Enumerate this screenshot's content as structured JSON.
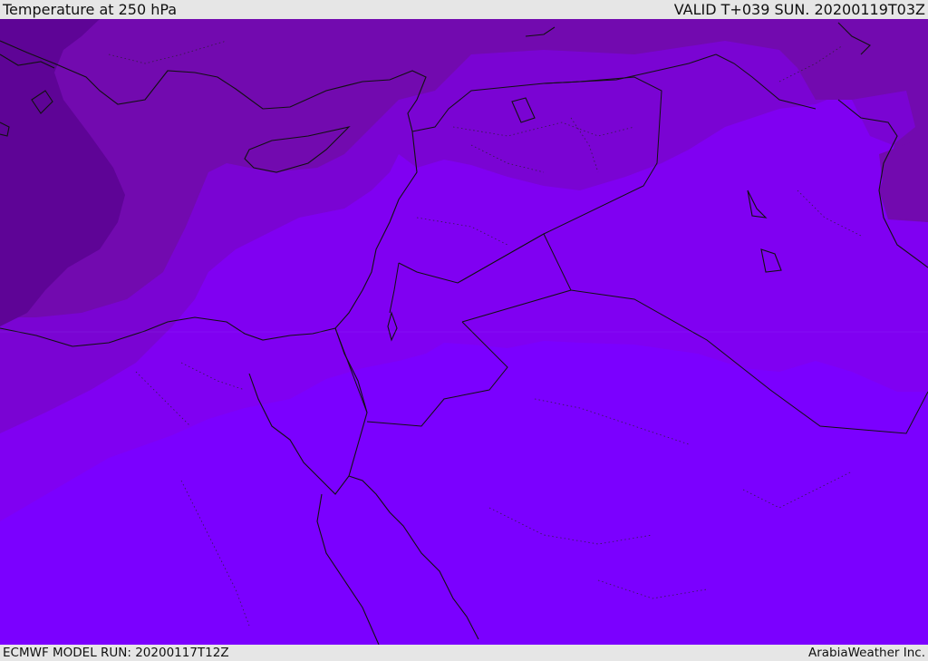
{
  "header": {
    "title": "Temperature at 250 hPa",
    "valid": "VALID T+039 SUN. 20200119T03Z"
  },
  "footer": {
    "model_run": "ECMWF MODEL RUN: 20200117T12Z",
    "credit": "ArabiaWeather Inc."
  },
  "colors": {
    "band_darkest": "#5e0496",
    "band_dark": "#720aaf",
    "band_mid": "#7a04d3",
    "band_light": "#8000f2",
    "band_lightest": "#7b00ff",
    "coastline": "#111111"
  },
  "icons": {
    "map": "filled-contour-map"
  }
}
